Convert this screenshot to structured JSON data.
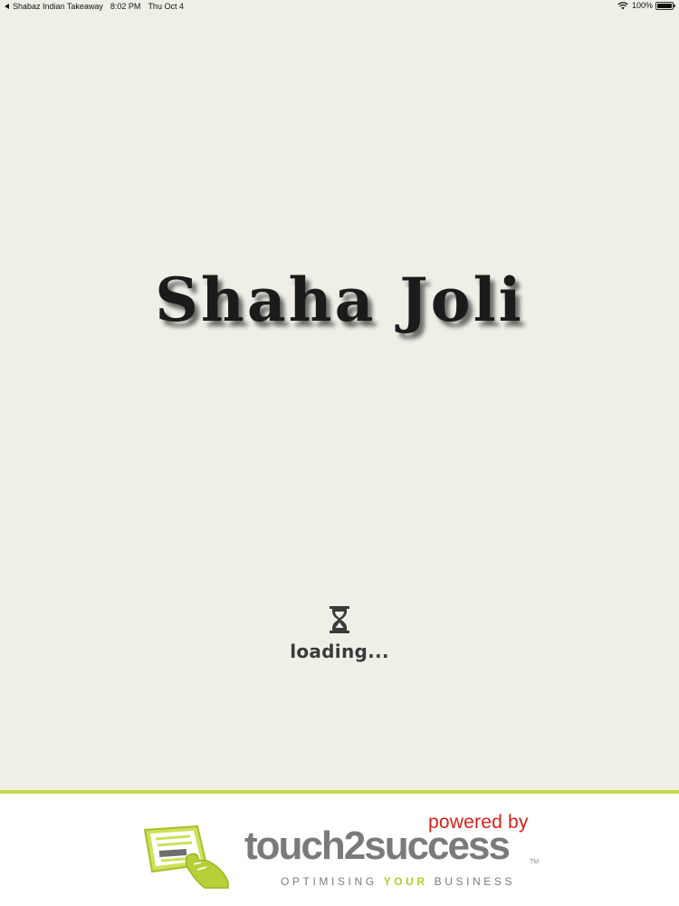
{
  "status_bar": {
    "back_label": "Shabaz Indian Takeaway",
    "time": "8:02 PM",
    "date": "Thu Oct 4",
    "battery": "100%",
    "icons": [
      "back-arrow-icon",
      "wifi-icon",
      "battery-icon"
    ]
  },
  "splash": {
    "restaurant_name": "Shaha Joli",
    "loading_text": "loading...",
    "loading_icon": "hourglass-icon"
  },
  "footer": {
    "powered_by": "powered by",
    "brand_name": "touch2success",
    "trademark": "TM",
    "tagline_start": "OPTIMISING",
    "tagline_highlight": "YOUR",
    "tagline_end": "BUSINESS",
    "colors": {
      "accent_green": "#c5d940",
      "powered_red": "#d8211b",
      "brand_gray": "#7a7a7a"
    }
  },
  "colors": {
    "background": "#efeee7"
  }
}
